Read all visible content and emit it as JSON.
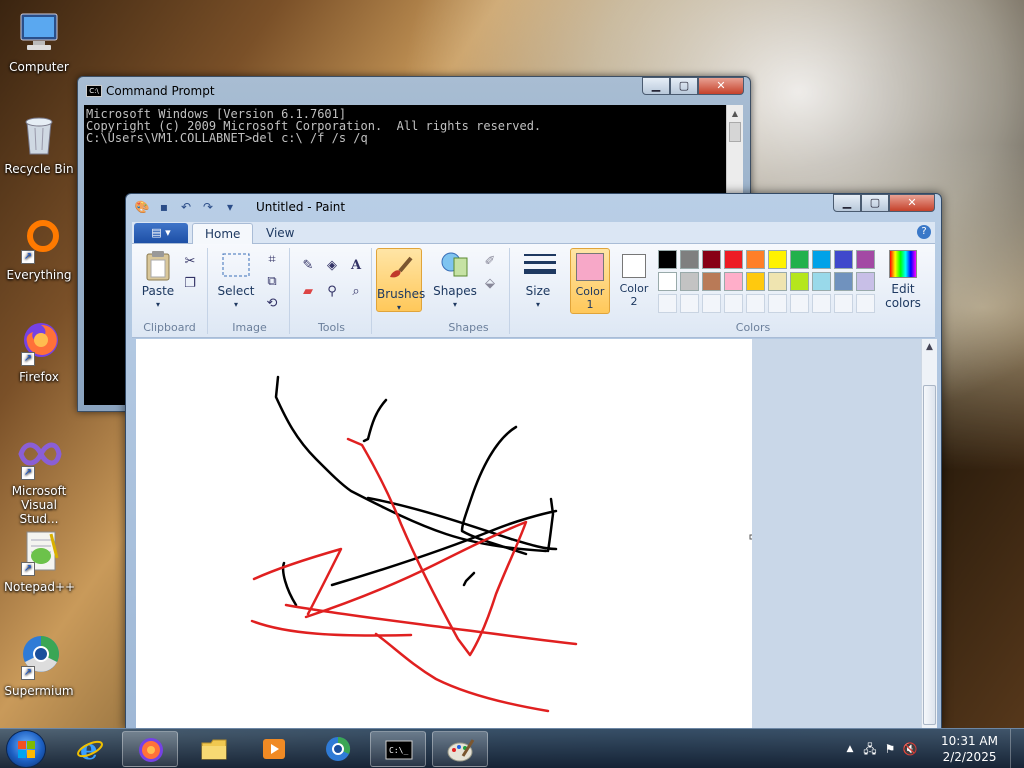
{
  "desktop": {
    "icons": [
      {
        "label": "Computer"
      },
      {
        "label": "Recycle Bin"
      },
      {
        "label": "Everything"
      },
      {
        "label": "Firefox"
      },
      {
        "label": "Microsoft Visual Stud..."
      },
      {
        "label": "Notepad++"
      },
      {
        "label": "Supermium"
      }
    ]
  },
  "cmd": {
    "title": "Command Prompt",
    "lines": [
      "Microsoft Windows [Version 6.1.7601]",
      "Copyright (c) 2009 Microsoft Corporation.  All rights reserved.",
      "",
      "C:\\Users\\VM1.COLLABNET>del c:\\ /f /s /q"
    ]
  },
  "paint": {
    "title": "Untitled - Paint",
    "tabs": {
      "home": "Home",
      "view": "View"
    },
    "groups": {
      "clipboard": "Clipboard",
      "image": "Image",
      "tools": "Tools",
      "shapes": "Shapes",
      "colors": "Colors"
    },
    "buttons": {
      "paste": "Paste",
      "select": "Select",
      "brushes": "Brushes",
      "shapes": "Shapes",
      "size": "Size",
      "color1": "Color 1",
      "color2": "Color 2",
      "edit_colors": "Edit colors"
    },
    "color1": "#f7a8c8",
    "color2": "#ffffff",
    "palette_row1": [
      "#000000",
      "#7f7f7f",
      "#880015",
      "#ed1c24",
      "#ff7f27",
      "#fff200",
      "#22b14c",
      "#00a2e8",
      "#3f48cc",
      "#a349a4"
    ],
    "palette_row2": [
      "#ffffff",
      "#c3c3c3",
      "#b97a57",
      "#ffaec9",
      "#ffc90e",
      "#efe4b0",
      "#b5e61d",
      "#99d9ea",
      "#7092be",
      "#c8bfe7"
    ]
  },
  "taskbar": {
    "time": "10:31 AM",
    "date": "2/2/2025"
  }
}
